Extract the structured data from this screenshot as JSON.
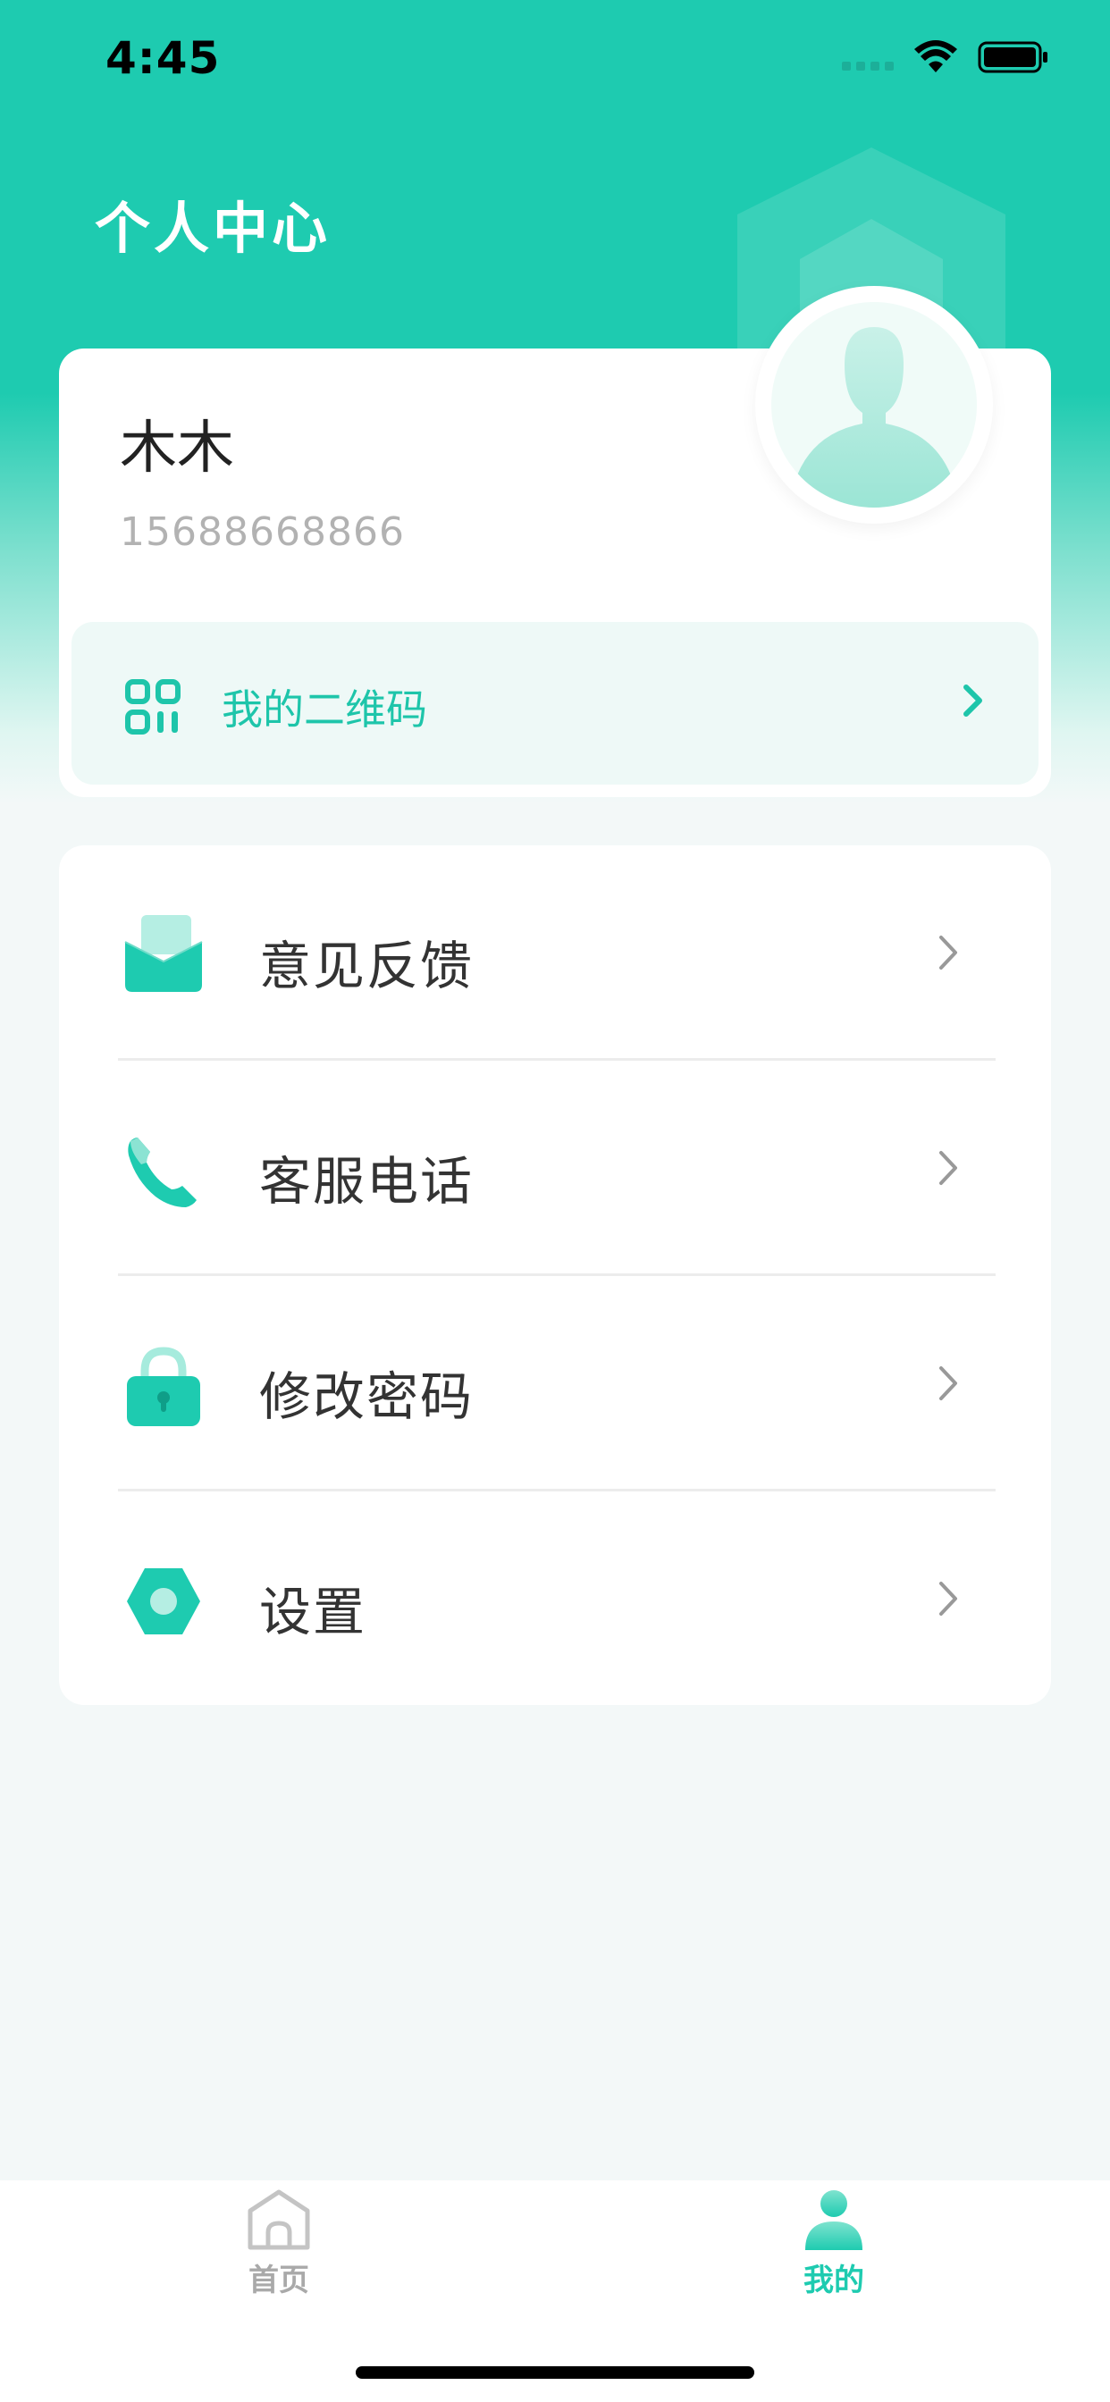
{
  "status_bar": {
    "time": "4:45"
  },
  "header": {
    "title": "个人中心"
  },
  "profile": {
    "name": "木木",
    "phone": "15688668866",
    "qr_label": "我的二维码"
  },
  "menu": {
    "items": [
      {
        "label": "意见反馈",
        "icon": "feedback-envelope-icon"
      },
      {
        "label": "客服电话",
        "icon": "phone-icon"
      },
      {
        "label": "修改密码",
        "icon": "lock-icon"
      },
      {
        "label": "设置",
        "icon": "settings-hexagon-icon"
      }
    ]
  },
  "tab_bar": {
    "tabs": [
      {
        "label": "首页",
        "icon": "home-icon",
        "active": false
      },
      {
        "label": "我的",
        "icon": "user-icon",
        "active": true
      }
    ]
  },
  "colors": {
    "accent": "#1ecbb0",
    "accent_text": "#1ec5aa",
    "inactive_tab": "#a9a9a9"
  }
}
